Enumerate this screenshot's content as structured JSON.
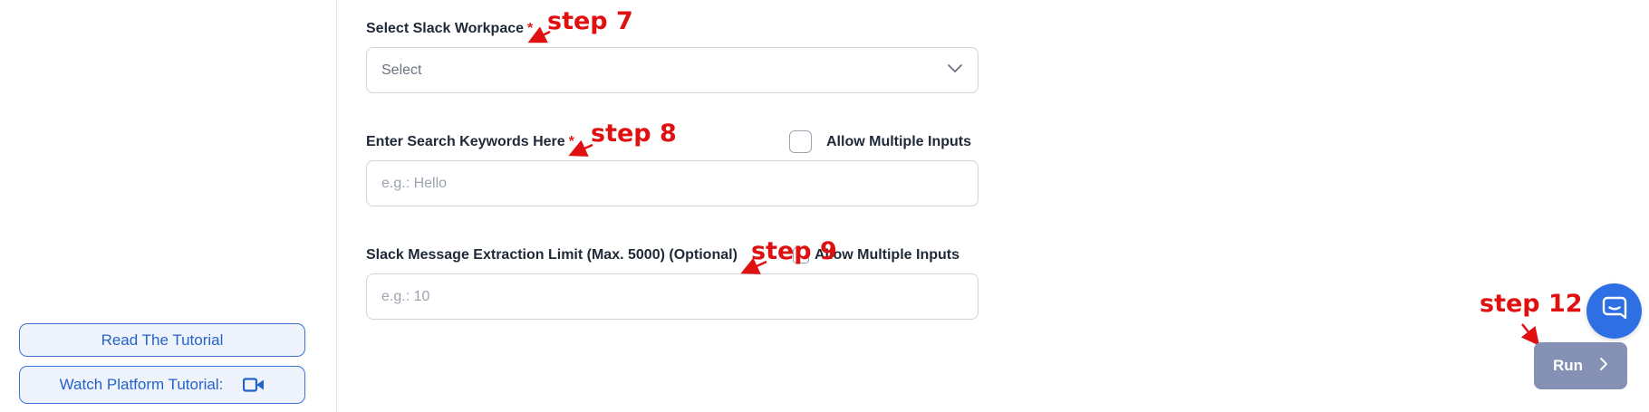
{
  "sidebar": {
    "tutorial_label": "Read The Tutorial",
    "platform_label": "Watch Platform Tutorial:",
    "platform_icon": "video-camera-icon"
  },
  "form": {
    "workspace": {
      "label": "Select Slack Workpace",
      "required": "*",
      "placeholder": "Select",
      "icon": "chevron-down-icon"
    },
    "keywords": {
      "label": "Enter Search Keywords Here",
      "required": "*",
      "placeholder": "e.g.: Hello",
      "multi_label": "Allow Multiple Inputs"
    },
    "limit": {
      "label": "Slack Message Extraction Limit (Max. 5000) (Optional)",
      "placeholder": "e.g.: 10",
      "multi_label": "Allow Multiple Inputs"
    }
  },
  "annotations": {
    "step7": "step 7",
    "step8": "step 8",
    "step9": "step 9",
    "step12": "step 12"
  },
  "actions": {
    "run_label": "Run",
    "run_icon": "chevron-right-icon",
    "chat_icon": "chat-bubble-icon"
  },
  "colors": {
    "accent": "#2f6fe4",
    "annotation": "#e01010",
    "run_button": "#8590b5",
    "sidebar_button_border": "#3b74d6"
  }
}
